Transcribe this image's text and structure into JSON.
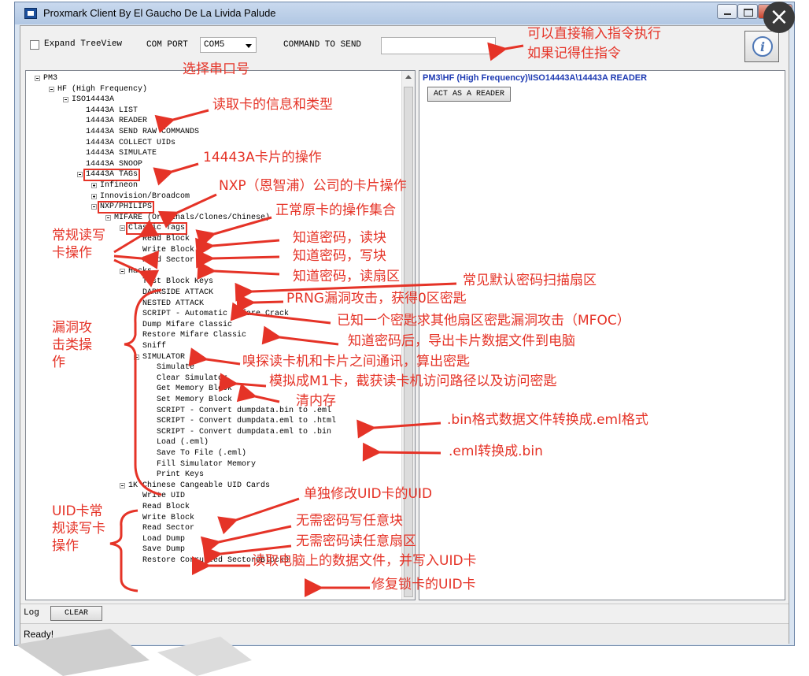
{
  "window": {
    "title": "Proxmark Client By El Gaucho De La Livida Palude"
  },
  "toolbar": {
    "expand_label": "Expand TreeView",
    "com_port_label": "COM PORT",
    "com_port_value": "COM5",
    "command_label": "COMMAND TO SEND",
    "command_value": ""
  },
  "tree": [
    {
      "label": "PM3",
      "depth": 0,
      "expander": "minus"
    },
    {
      "label": "HF (High Frequency)",
      "depth": 1,
      "expander": "minus"
    },
    {
      "label": "ISO14443A",
      "depth": 2,
      "expander": "minus"
    },
    {
      "label": "14443A LIST",
      "depth": 3
    },
    {
      "label": "14443A READER",
      "depth": 3
    },
    {
      "label": "14443A SEND RAW COMMANDS",
      "depth": 3
    },
    {
      "label": "14443A COLLECT UIDs",
      "depth": 3
    },
    {
      "label": "14443A SIMULATE",
      "depth": 3
    },
    {
      "label": "14443A SNOOP",
      "depth": 3
    },
    {
      "label": "14443A TAGs",
      "depth": 3,
      "expander": "minus",
      "boxed": true
    },
    {
      "label": "Infineon",
      "depth": 4,
      "expander": "plus"
    },
    {
      "label": "Innovision/Broadcom",
      "depth": 4,
      "expander": "plus"
    },
    {
      "label": "NXP/PHILIPS",
      "depth": 4,
      "expander": "minus",
      "boxed": true
    },
    {
      "label": "MIFARE (Originals/Clones/Chinese)",
      "depth": 5,
      "expander": "minus"
    },
    {
      "label": "Classic Tags",
      "depth": 6,
      "expander": "minus",
      "boxed": true
    },
    {
      "label": "Read Block",
      "depth": 7
    },
    {
      "label": "Write Block",
      "depth": 7
    },
    {
      "label": "Read Sector",
      "depth": 7
    },
    {
      "label": "Hacks",
      "depth": 6,
      "expander": "minus"
    },
    {
      "label": "Test Block Keys",
      "depth": 7
    },
    {
      "label": "DARKSIDE ATTACK",
      "depth": 7
    },
    {
      "label": "NESTED ATTACK",
      "depth": 7
    },
    {
      "label": "SCRIPT - Automatic Mifare Crack",
      "depth": 7
    },
    {
      "label": "Dump Mifare Classic",
      "depth": 7
    },
    {
      "label": "Restore Mifare Classic",
      "depth": 7
    },
    {
      "label": "Sniff",
      "depth": 7
    },
    {
      "label": "SIMULATOR",
      "depth": 7,
      "expander": "minus"
    },
    {
      "label": "Simulate",
      "depth": 8
    },
    {
      "label": "Clear Simulator",
      "depth": 8
    },
    {
      "label": "Get Memory Block",
      "depth": 8
    },
    {
      "label": "Set Memory Block",
      "depth": 8
    },
    {
      "label": "SCRIPT - Convert dumpdata.bin to .eml",
      "depth": 8
    },
    {
      "label": "SCRIPT - Convert dumpdata.eml to .html",
      "depth": 8
    },
    {
      "label": "SCRIPT - Convert dumpdata.eml to .bin",
      "depth": 8
    },
    {
      "label": "Load (.eml)",
      "depth": 8
    },
    {
      "label": "Save To File (.eml)",
      "depth": 8
    },
    {
      "label": "Fill Simulator Memory",
      "depth": 8
    },
    {
      "label": "Print Keys",
      "depth": 8
    },
    {
      "label": "1K Chinese Cangeable UID Cards",
      "depth": 6,
      "expander": "minus"
    },
    {
      "label": "Write UID",
      "depth": 7
    },
    {
      "label": "Read Block",
      "depth": 7
    },
    {
      "label": "Write Block",
      "depth": 7
    },
    {
      "label": "Read Sector",
      "depth": 7
    },
    {
      "label": "Load Dump",
      "depth": 7
    },
    {
      "label": "Save Dump",
      "depth": 7
    },
    {
      "label": "Restore Corrupted Sector0Block0",
      "depth": 7
    }
  ],
  "right_panel": {
    "breadcrumb": "PM3\\HF (High Frequency)\\ISO14443A\\14443A READER",
    "action_button": "ACT AS A READER"
  },
  "log": {
    "label": "Log",
    "clear_button": "CLEAR"
  },
  "status": {
    "text": "Ready!"
  },
  "annotations": [
    {
      "text": "可以直接输入指令执行"
    },
    {
      "text": "如果记得住指令"
    },
    {
      "text": "选择串口号"
    },
    {
      "text": "读取卡的信息和类型"
    },
    {
      "text": "14443A卡片的操作"
    },
    {
      "text": "NXP（恩智浦）公司的卡片操作"
    },
    {
      "text": "正常原卡的操作集合"
    },
    {
      "text": "知道密码，读块"
    },
    {
      "text": "知道密码，写块"
    },
    {
      "text": "知道密码，读扇区"
    },
    {
      "text": "常见默认密码扫描扇区"
    },
    {
      "text": "PRNG漏洞攻击，获得0区密匙"
    },
    {
      "text": "已知一个密匙求其他扇区密匙漏洞攻击（MFOC）"
    },
    {
      "text": "知道密码后，导出卡片数据文件到电脑"
    },
    {
      "text": "嗅探读卡机和卡片之间通讯，算出密匙"
    },
    {
      "text": "模拟成M1卡，截获读卡机访问路径以及访问密匙"
    },
    {
      "text": "清内存"
    },
    {
      "text": ".bin格式数据文件转换成.eml格式"
    },
    {
      "text": ".eml转换成.bin"
    },
    {
      "text": "单独修改UID卡的UID"
    },
    {
      "text": "无需密码写任意块"
    },
    {
      "text": "无需密码读任意扇区"
    },
    {
      "text": "读取电脑上的数据文件，并写入UID卡"
    },
    {
      "text": "修复锁卡的UID卡"
    },
    {
      "text": "常规读写卡操作"
    },
    {
      "text": "漏洞攻击类操作"
    },
    {
      "text": "UID卡常规读写卡操作"
    }
  ],
  "colors": {
    "annotation": "#e53327",
    "breadcrumb": "#1e3bb3"
  }
}
